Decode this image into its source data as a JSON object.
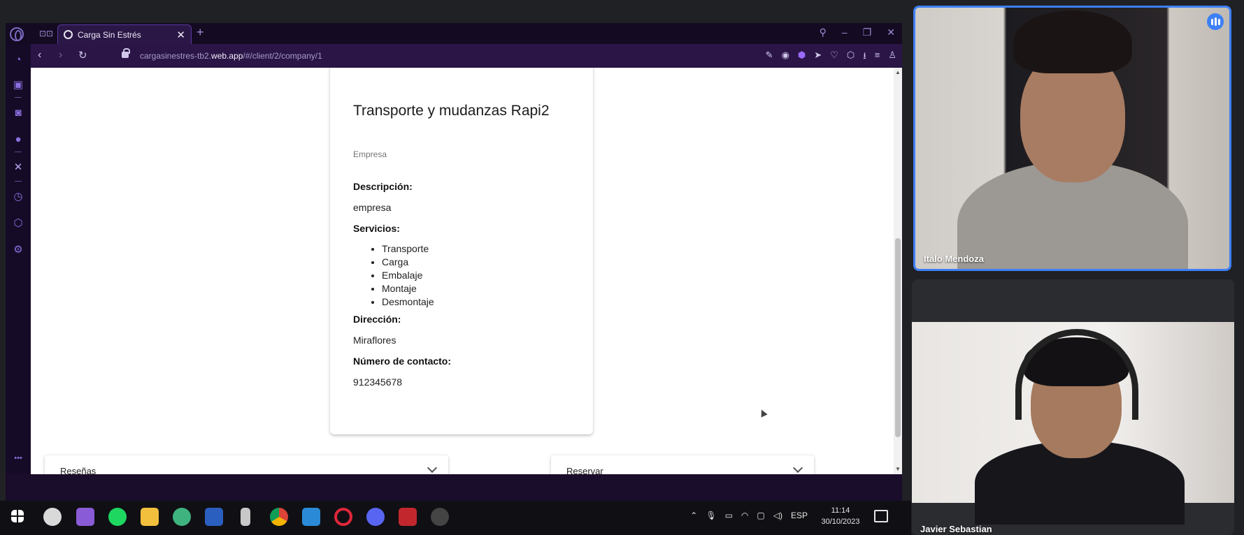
{
  "browser": {
    "tab_title": "Carga Sin Estrés",
    "url_prefix": "cargasinestres-tb2.",
    "url_domain": "web.app",
    "url_path": "/#/client/2/company/1"
  },
  "company": {
    "name": "Transporte y mudanzas Rapi2",
    "subtitle": "Empresa",
    "description_label": "Descripción:",
    "description": "empresa",
    "services_label": "Servicios:",
    "services": [
      "Transporte",
      "Carga",
      "Embalaje",
      "Montaje",
      "Desmontaje"
    ],
    "address_label": "Dirección:",
    "address": "Miraflores",
    "contact_label": "Número de contacto:",
    "contact": "912345678"
  },
  "panels": {
    "reviews": "Reseñas",
    "reserve": "Reservar"
  },
  "taskbar": {
    "lang": "ESP",
    "time": "11:14",
    "date": "30/10/2023"
  },
  "meeting": {
    "participant1": "Italo Mendoza",
    "participant2": "Javier Sebastian"
  },
  "colors": {
    "accent": "#3d7ff6",
    "browser_bg": "#1a0c2b",
    "sidebar_icon": "#8b6fe0"
  }
}
